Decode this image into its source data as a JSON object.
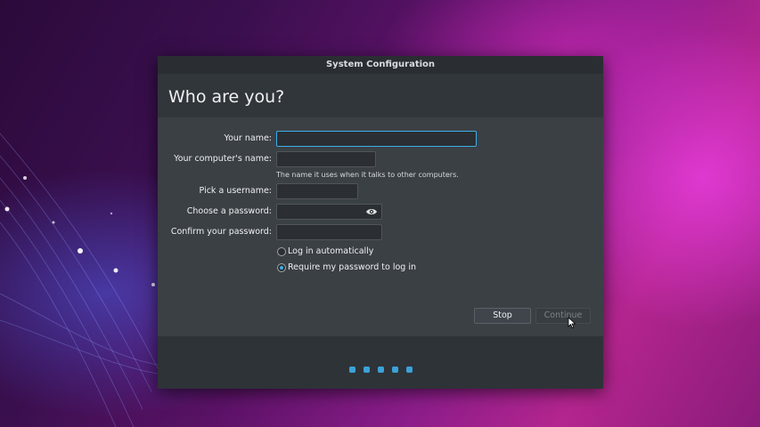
{
  "window": {
    "title": "System Configuration"
  },
  "page": {
    "heading": "Who are you?"
  },
  "form": {
    "your_name": {
      "label": "Your name:",
      "value": ""
    },
    "computer_name": {
      "label": "Your computer's name:",
      "value": "",
      "hint": "The name it uses when it talks to other computers."
    },
    "username": {
      "label": "Pick a username:",
      "value": ""
    },
    "password": {
      "label": "Choose a password:",
      "value": "",
      "icon": "eye-icon"
    },
    "confirm_password": {
      "label": "Confirm your password:",
      "value": ""
    },
    "login_options": [
      {
        "label": "Log in automatically",
        "checked": false
      },
      {
        "label": "Require my password to log in",
        "checked": true
      }
    ]
  },
  "buttons": {
    "stop": "Stop",
    "continue": "Continue"
  },
  "progress": {
    "step_count": 5
  },
  "colors": {
    "accent": "#3daee9",
    "dialog_bg": "#31363b",
    "form_bg": "#3b4045"
  }
}
